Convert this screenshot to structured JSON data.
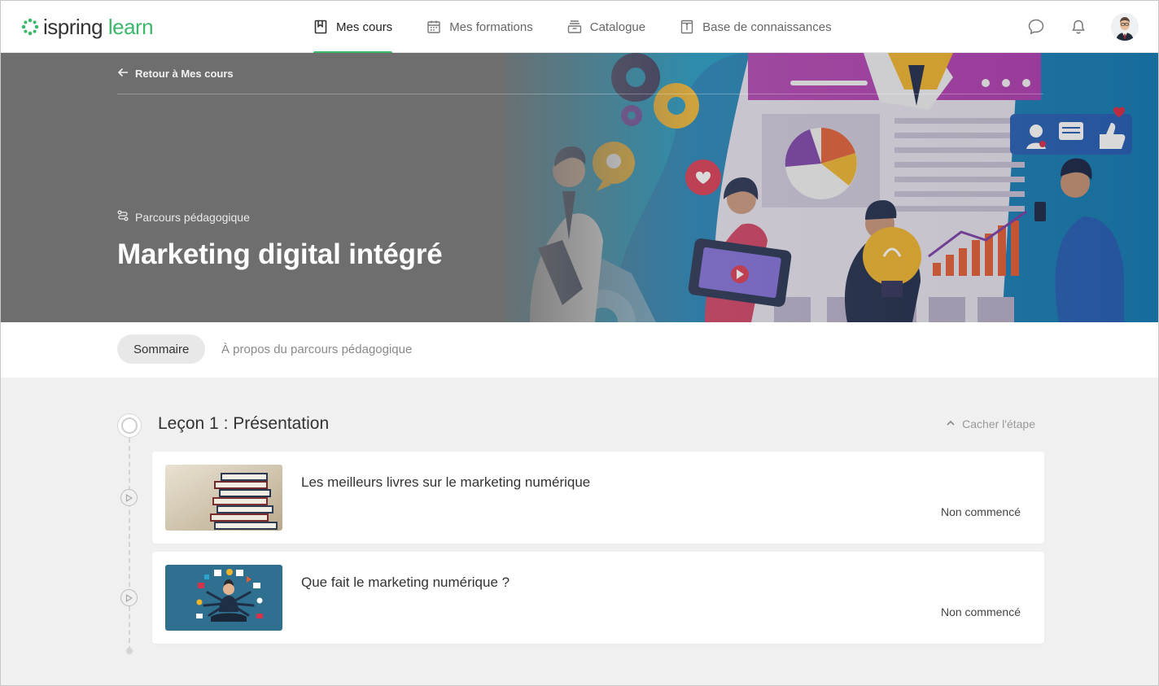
{
  "header": {
    "logo_part1": "ispring",
    "logo_part2": "learn",
    "nav": [
      {
        "label": "Mes cours",
        "icon": "book-icon",
        "active": true
      },
      {
        "label": "Mes formations",
        "icon": "calendar-icon",
        "active": false
      },
      {
        "label": "Catalogue",
        "icon": "archive-box-icon",
        "active": false
      },
      {
        "label": "Base de connaissances",
        "icon": "info-book-icon",
        "active": false
      }
    ],
    "icons": [
      "chat-icon",
      "bell-icon"
    ],
    "accent_color": "#3cb86b"
  },
  "hero": {
    "back_label": "Retour à Mes cours",
    "type_label": "Parcours pédagogique",
    "title": "Marketing digital intégré"
  },
  "tabs": [
    {
      "label": "Sommaire",
      "active": true
    },
    {
      "label": "À propos du parcours pédagogique",
      "active": false
    }
  ],
  "lesson": {
    "title": "Leçon 1 : Présentation",
    "toggle_label": "Cacher l'étape",
    "items": [
      {
        "title": "Les meilleurs livres sur le marketing numérique",
        "status": "Non commencé",
        "thumbnail": "books-stack"
      },
      {
        "title": "Que fait le marketing numérique ?",
        "status": "Non commencé",
        "thumbnail": "multitasking-marketer"
      }
    ]
  }
}
